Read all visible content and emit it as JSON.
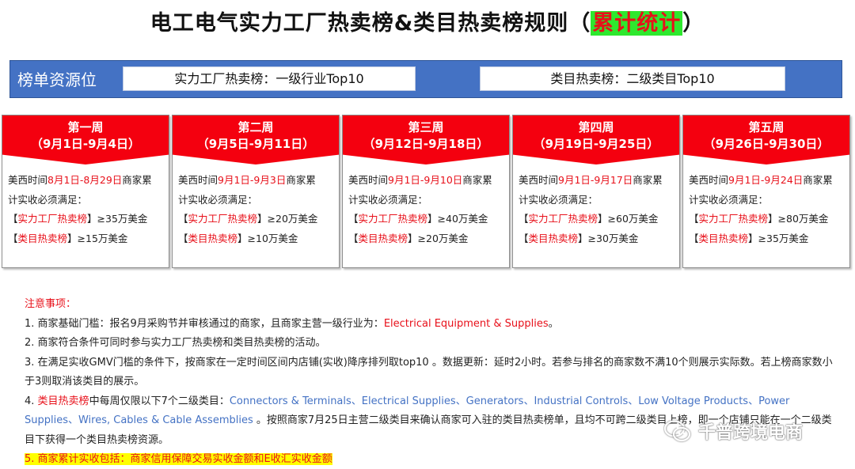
{
  "title": {
    "main": "电工电气实力工厂热卖榜&类目热卖榜规则（",
    "highlight": "累计统计",
    "end": "）"
  },
  "resource": {
    "label": "榜单资源位",
    "box_a": "实力工厂热卖榜：一级行业Top10",
    "box_b": "类目热卖榜：二级类目Top10"
  },
  "weeks": [
    {
      "name": "第一周",
      "range": "（9月1日-9月4日）",
      "pre": "美西时间",
      "period": "8月1日-8月29日",
      "post": "商家累",
      "line2": "计实收必须满足：",
      "factory_label": "实力工厂热卖榜",
      "factory_req": "≥35万美金",
      "category_label": "类目热卖榜",
      "category_req": "≥15万美金"
    },
    {
      "name": "第二周",
      "range": "（9月5日-9月11日）",
      "pre": "美西时间",
      "period": "9月1日-9月3日",
      "post": "商家累",
      "line2": "计实收必须满足：",
      "factory_label": "实力工厂热卖榜",
      "factory_req": "≥20万美金",
      "category_label": "类目热卖榜",
      "category_req": "≥10万美金"
    },
    {
      "name": "第三周",
      "range": "（9月12日-9月18日）",
      "pre": "美西时间",
      "period": "9月1日-9月10日",
      "post": "商家累",
      "line2": "计实收必须满足：",
      "factory_label": "实力工厂热卖榜",
      "factory_req": "≥40万美金",
      "category_label": "类目热卖榜",
      "category_req": "≥20万美金"
    },
    {
      "name": "第四周",
      "range": "（9月19日-9月25日）",
      "pre": "美西时间",
      "period": "9月1日-9月17日",
      "post": "商家累",
      "line2": "计实收必须满足：",
      "factory_label": "实力工厂热卖榜",
      "factory_req": "≥60万美金",
      "category_label": "类目热卖榜",
      "category_req": "≥30万美金"
    },
    {
      "name": "第五周",
      "range": "（9月26日-9月30日）",
      "pre": "美西时间",
      "period": "9月1日-9月24日",
      "post": "商家累",
      "line2": "计实收必须满足：",
      "factory_label": "实力工厂热卖榜",
      "factory_req": "≥80万美金",
      "category_label": "类目热卖榜",
      "category_req": "≥35万美金"
    }
  ],
  "notes": {
    "title": "注意事项：",
    "n1_pre": "1. 商家基础门槛：报名9月采购节并审核通过的商家，且商家主营一级行业为：",
    "n1_red": "Electrical Equipment & Supplies",
    "n1_post": "。",
    "n2": "2. 商家符合条件可同时参与实力工厂热卖榜和类目热卖榜的活动。",
    "n3": "3. 在满足实收GMV门槛的条件下，按商家在一定时间区间内店铺(实收)降序排列取top10 。数据更新：延时2小时。若参与排名的商家数不满10个则展示实际数。若上榜商家数小于3则取消该类目的展示。",
    "n4_pre": "4. ",
    "n4_red": "类目热卖榜",
    "n4_mid": "中每周仅限以下7个二级类目：",
    "n4_cats": "Connectors & Terminals、Electrical Supplies、Generators、Industrial Controls、Low Voltage Products、Power Supplies、Wires, Cables & Cable Assemblies",
    "n4_post": " 。按照商家7月25日主营二级类目来确认商家可入驻的类目热卖榜单，且均不可跨二级类目上榜，即一个店铺只能在一个二级类目下获得一个类目热卖榜资源。",
    "n5": "5. 商家累计实收包括：商家信用保障交易实收金额和E收汇实收金额"
  },
  "watermark": {
    "text": "千普跨境电商",
    "icon": "wechat-icon"
  }
}
